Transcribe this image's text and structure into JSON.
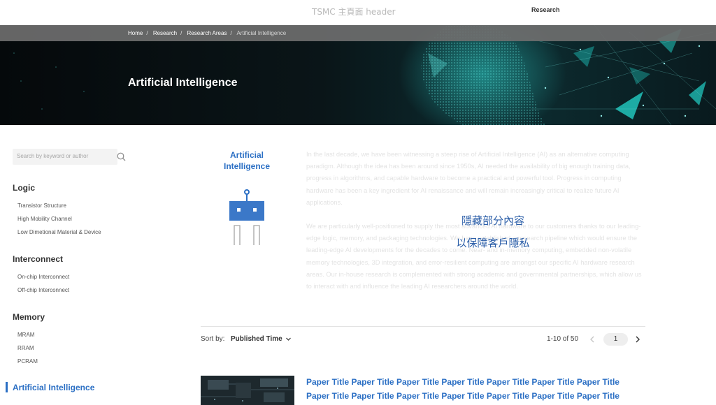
{
  "header": {
    "brand": "TSMC 主頁面 header",
    "nav_research": "Research"
  },
  "breadcrumb": {
    "items": [
      "Home",
      "Research",
      "Research Areas",
      "Artificial Intelligence"
    ],
    "separator": "/"
  },
  "hero": {
    "title": "Artificial Intelligence"
  },
  "search": {
    "placeholder": "Search by keyword or author"
  },
  "sidebar": {
    "groups": [
      {
        "heading": "Logic",
        "items": [
          "Transistor Structure",
          "High Mobility Channel",
          "Low Dimetional Material & Device"
        ]
      },
      {
        "heading": "Interconnect",
        "items": [
          "On-chip Interconnect",
          "Off-chip Interconnect"
        ]
      },
      {
        "heading": "Memory",
        "items": [
          "MRAM",
          "RRAM",
          "PCRAM"
        ]
      }
    ],
    "active": "Artificial Intelligence"
  },
  "intro": {
    "title": "Artificial Intelligence",
    "paragraphs": [
      "In the last decade, we have been witnessing a steep rise of Artificial Intelligence (AI) as an alternative computing paradigm. Although the idea has been around since 1950s, AI needed the availability of big enough training data, progress in algorithms, and capable hardware to become a practical and powerful tool. Progress in computing hardware has been a key ingredient for AI renaissance and will remain increasingly critical to realize future AI applications.",
      "We are particularly well-positioned to supply the most advanced AI hardware to our customers thanks to our leading-edge logic, memory, and packaging technologies. We have established a research pipeline which would ensure the leading-edge AI developments for the decades to come. Near- and in-memory computing, embedded non-volatile memory technologies, 3D integration, and error-resilient computing are amongst our specific AI hardware research areas. Our in-house research is complemented with strong academic and governmental partnerships, which allow us to interact with and influence the leading AI researchers around the world."
    ],
    "hidden_note": [
      "隱藏部分內容",
      "以保障客戶隱私"
    ]
  },
  "listing": {
    "sort_label": "Sort by:",
    "sort_value": "Published Time",
    "range": "1-10 of 50",
    "current_page": "1",
    "paper_title": "Paper Title Paper Title Paper Title Paper Title Paper Title Paper Title Paper Title Paper Title Paper Title Paper Title Paper Title Paper Title Paper Title Paper Title"
  },
  "colors": {
    "accent": "#2b6fc4",
    "breadcrumb_bar": "#6e6e6e",
    "hero_teal": "#19c6c0"
  }
}
